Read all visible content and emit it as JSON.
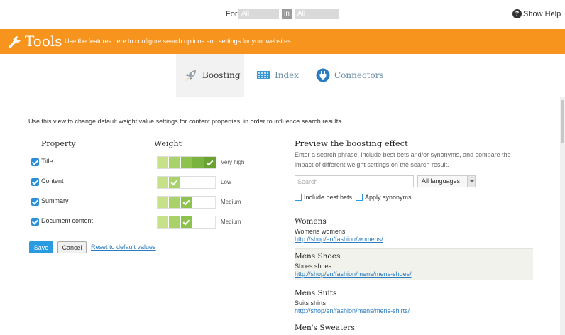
{
  "topbar": {
    "for_label": "For",
    "websites": "All Websites",
    "in_label": "in",
    "languages": "All languages",
    "help": "Show Help"
  },
  "tools": {
    "title": "Tools",
    "description": "Use the features here to configure search options and settings for your websites."
  },
  "tabs": [
    {
      "label": "Boosting",
      "icon": "rocket-icon",
      "active": true
    },
    {
      "label": "Index",
      "icon": "table-icon",
      "active": false
    },
    {
      "label": "Connectors",
      "icon": "plug-icon",
      "active": false
    }
  ],
  "intro": "Use this view to change default weight value settings for content properties, in order to influence search results.",
  "properties": {
    "header_property": "Property",
    "header_weight": "Weight",
    "rows": [
      {
        "label": "Title",
        "checked": true,
        "level": 5,
        "weight_label": "Very high"
      },
      {
        "label": "Content",
        "checked": true,
        "level": 2,
        "weight_label": "Low"
      },
      {
        "label": "Summary",
        "checked": true,
        "level": 3,
        "weight_label": "Medium"
      },
      {
        "label": "Document content",
        "checked": true,
        "level": 3,
        "weight_label": "Medium"
      }
    ]
  },
  "actions": {
    "save": "Save",
    "cancel": "Cancel",
    "reset": "Reset to default values"
  },
  "preview": {
    "title": "Preview the boosting effect",
    "description": "Enter a search phrase, include best bets and/or synonyms, and compare the impact of different weight settings on the search result.",
    "search_placeholder": "Search",
    "language": "All languages",
    "include_best_bets": "Include best bets",
    "apply_synonyms": "Apply synonyms",
    "results": [
      {
        "title": "Womens",
        "snippet": "Womens womens",
        "url": "http://shop/en/fashion/womens/"
      },
      {
        "title": "Mens Shoes",
        "snippet": "Shoes shoes",
        "url": "http://shop/en/fashion/mens/mens-shoes/"
      },
      {
        "title": "Mens Suits",
        "snippet": "Suits shirts",
        "url": "http://shop/en/fashion/mens/mens-shirts/"
      },
      {
        "title": "Men's Sweaters",
        "snippet": "",
        "url": ""
      }
    ]
  },
  "colors": {
    "accent": "#f7941d",
    "link": "#2a7bbf",
    "primary_button": "#2a9be0"
  }
}
